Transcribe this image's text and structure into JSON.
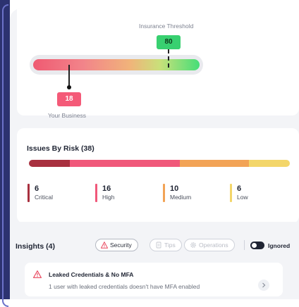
{
  "threshold": {
    "label": "Insurance Threshold",
    "value": "80",
    "color": "#38d070"
  },
  "business": {
    "label": "Your Business",
    "value": "18",
    "color": "#f45a78"
  },
  "issues": {
    "title": "Issues By Risk (38)",
    "total": 38,
    "levels": [
      {
        "count": "6",
        "label": "Critical",
        "color": "#a8303f"
      },
      {
        "count": "16",
        "label": "High",
        "color": "#f0587a"
      },
      {
        "count": "10",
        "label": "Medium",
        "color": "#f2a356"
      },
      {
        "count": "6",
        "label": "Low",
        "color": "#f3d66a"
      }
    ]
  },
  "insights": {
    "title": "Insights (4)",
    "filters": [
      {
        "label": "Security",
        "icon": "warning-icon",
        "active": true
      },
      {
        "label": "Tips",
        "icon": "lightbulb-icon",
        "active": false
      },
      {
        "label": "Operations",
        "icon": "gear-icon",
        "active": false
      }
    ],
    "toggle_label": "Ignored",
    "items": [
      {
        "title": "Leaked Credentials & No MFA",
        "description": "1 user with leaked credentials doesn't have MFA enabled",
        "icon": "warning-icon"
      }
    ]
  }
}
